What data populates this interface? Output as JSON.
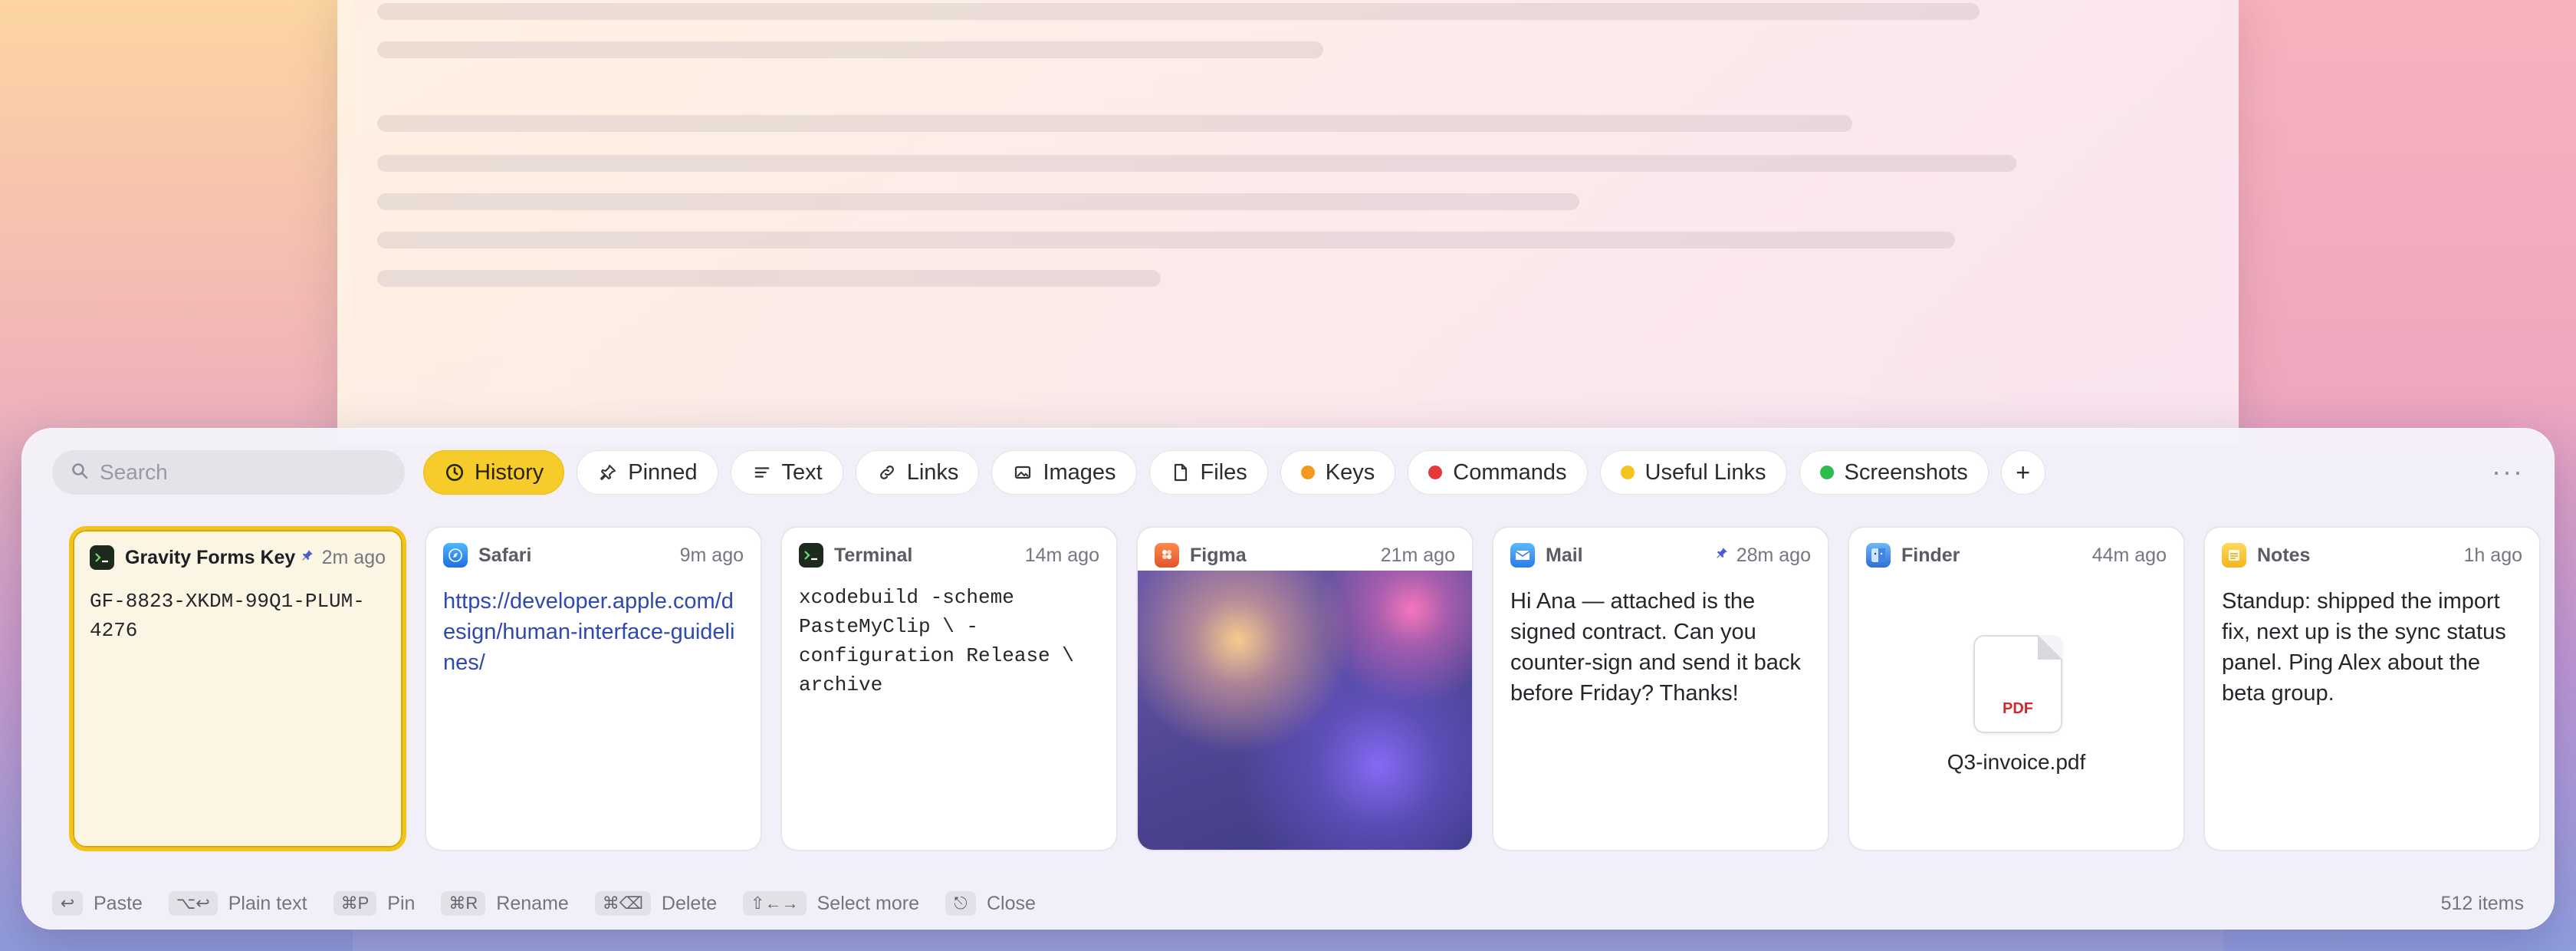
{
  "search": {
    "placeholder": "Search"
  },
  "tabs": [
    {
      "label": "History",
      "icon": "clock-icon",
      "active": true
    },
    {
      "label": "Pinned",
      "icon": "pin-icon"
    },
    {
      "label": "Text",
      "icon": "text-lines-icon"
    },
    {
      "label": "Links",
      "icon": "link-icon"
    },
    {
      "label": "Images",
      "icon": "image-icon"
    },
    {
      "label": "Files",
      "icon": "file-icon"
    },
    {
      "label": "Keys",
      "color": "#f39a1a"
    },
    {
      "label": "Commands",
      "color": "#e8393a"
    },
    {
      "label": "Useful Links",
      "color": "#f4c61b"
    },
    {
      "label": "Screenshots",
      "color": "#2dbd4a"
    }
  ],
  "add_label": "+",
  "more_label": "···",
  "cards": [
    {
      "app": "Gravity Forms Key",
      "time": "2m ago",
      "pinned": true,
      "content": "GF-8823-XKDM-99Q1-PLUM-4276"
    },
    {
      "app": "Safari",
      "time": "9m ago",
      "content": "https://developer.apple.com/design/human-interface-guidelines/"
    },
    {
      "app": "Terminal",
      "time": "14m ago",
      "content": "xcodebuild -scheme PasteMyClip \\ -configuration Release \\ archive"
    },
    {
      "app": "Figma",
      "time": "21m ago"
    },
    {
      "app": "Mail",
      "time": "28m ago",
      "pinned": true,
      "content": "Hi Ana — attached is the signed contract. Can you counter-sign and send it back before Friday? Thanks!"
    },
    {
      "app": "Finder",
      "time": "44m ago",
      "file_badge": "PDF",
      "filename": "Q3-invoice.pdf"
    },
    {
      "app": "Notes",
      "time": "1h ago",
      "content": "Standup: shipped the import fix, next up is the sync status panel. Ping Alex about the beta group."
    }
  ],
  "footer": {
    "hints": [
      {
        "key": "↩",
        "label": "Paste"
      },
      {
        "key": "⌥↩",
        "label": "Plain text"
      },
      {
        "key": "⌘P",
        "label": "Pin"
      },
      {
        "key": "⌘R",
        "label": "Rename"
      },
      {
        "key": "⌘⌫",
        "label": "Delete"
      },
      {
        "key": "⇧←→",
        "label": "Select more"
      },
      {
        "key": "⎋",
        "label": "Close"
      }
    ],
    "count": "512 items"
  }
}
